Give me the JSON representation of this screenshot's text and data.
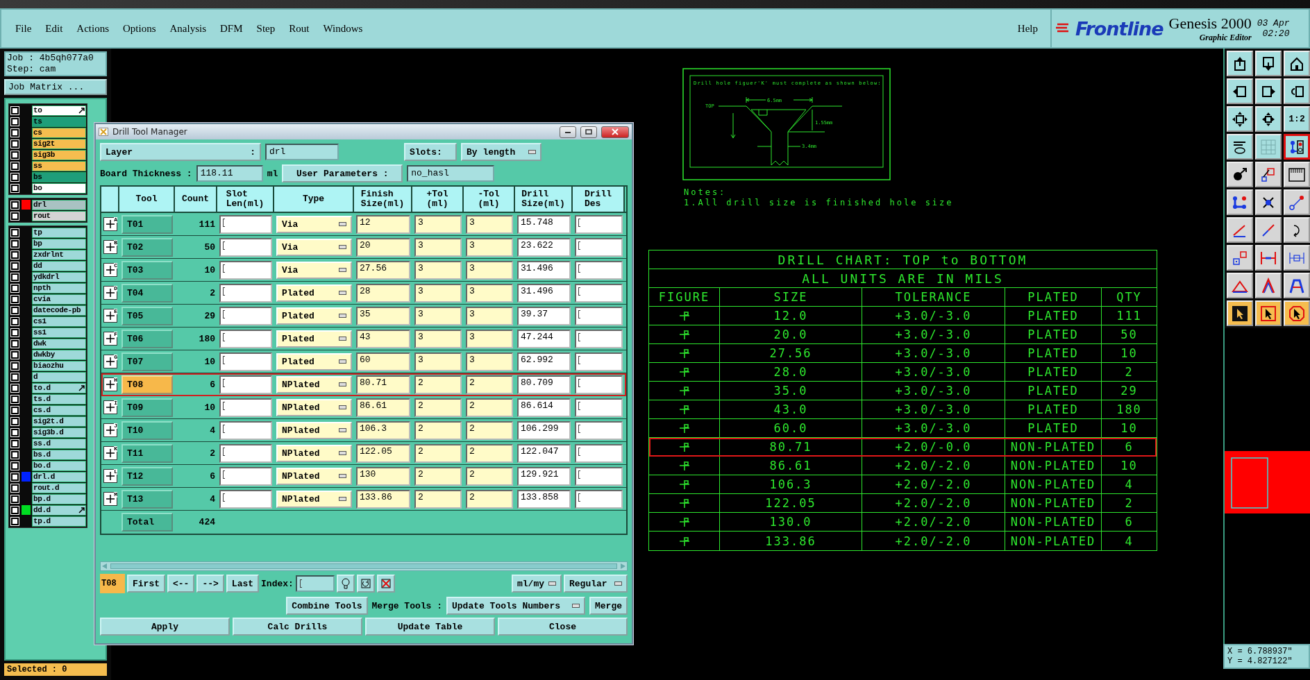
{
  "menu": {
    "items": [
      "File",
      "Edit",
      "Actions",
      "Options",
      "Analysis",
      "DFM",
      "Step",
      "Rout",
      "Windows"
    ],
    "help": "Help"
  },
  "logo": {
    "brand": "Frontline",
    "product": "Genesis 2000",
    "subtitle": "Graphic Editor",
    "date": "03 Apr",
    "time": "02:20"
  },
  "job": {
    "job": "Job : 4b5qh077a0",
    "step": "Step: cam",
    "matrix_button": "Job Matrix ..."
  },
  "layer_groups": [
    [
      {
        "name": "to",
        "kind": "silk",
        "linked": true,
        "checked": false
      },
      {
        "name": "ts",
        "kind": "mask",
        "linked": false,
        "checked": false
      },
      {
        "name": "cs",
        "kind": "signal",
        "linked": false,
        "checked": false
      },
      {
        "name": "sig2t",
        "kind": "signal",
        "linked": false,
        "checked": false
      },
      {
        "name": "sig3b",
        "kind": "signal",
        "linked": false,
        "checked": false
      },
      {
        "name": "ss",
        "kind": "signal",
        "linked": false,
        "checked": false
      },
      {
        "name": "bs",
        "kind": "mask",
        "linked": false,
        "checked": false
      },
      {
        "name": "bo",
        "kind": "silk",
        "linked": false,
        "checked": false
      }
    ],
    [
      {
        "name": "drl",
        "kind": "drill",
        "linked": false,
        "checked": false,
        "color": "#ff0000"
      },
      {
        "name": "rout",
        "kind": "rout",
        "linked": false,
        "checked": false
      }
    ],
    [
      {
        "name": "tp",
        "kind": "misc",
        "linked": false,
        "checked": false
      },
      {
        "name": "bp",
        "kind": "misc",
        "linked": false,
        "checked": false
      },
      {
        "name": "zxdrlnt",
        "kind": "misc",
        "linked": false,
        "checked": false
      },
      {
        "name": "dd",
        "kind": "misc",
        "linked": false,
        "checked": false
      },
      {
        "name": "ydkdrl",
        "kind": "misc",
        "linked": false,
        "checked": false
      },
      {
        "name": "npth",
        "kind": "misc",
        "linked": false,
        "checked": false
      },
      {
        "name": "cvia",
        "kind": "misc",
        "linked": false,
        "checked": false
      },
      {
        "name": "datecode-pb",
        "kind": "misc",
        "linked": false,
        "checked": false
      },
      {
        "name": "cs1",
        "kind": "misc",
        "linked": false,
        "checked": false
      },
      {
        "name": "ss1",
        "kind": "misc",
        "linked": false,
        "checked": false
      },
      {
        "name": "dwk",
        "kind": "misc",
        "linked": false,
        "checked": false
      },
      {
        "name": "dwkby",
        "kind": "misc",
        "linked": false,
        "checked": false
      },
      {
        "name": "biaozhu",
        "kind": "misc",
        "linked": false,
        "checked": false
      },
      {
        "name": "d",
        "kind": "misc",
        "linked": false,
        "checked": false
      },
      {
        "name": "to.d",
        "kind": "misc",
        "linked": true,
        "checked": false
      },
      {
        "name": "ts.d",
        "kind": "misc",
        "linked": false,
        "checked": false
      },
      {
        "name": "cs.d",
        "kind": "misc",
        "linked": false,
        "checked": false
      },
      {
        "name": "sig2t.d",
        "kind": "misc",
        "linked": false,
        "checked": false
      },
      {
        "name": "sig3b.d",
        "kind": "misc",
        "linked": false,
        "checked": false
      },
      {
        "name": "ss.d",
        "kind": "misc",
        "linked": false,
        "checked": false
      },
      {
        "name": "bs.d",
        "kind": "misc",
        "linked": false,
        "checked": false
      },
      {
        "name": "bo.d",
        "kind": "misc",
        "linked": false,
        "checked": false
      },
      {
        "name": "drl.d",
        "kind": "misc",
        "linked": false,
        "checked": false,
        "color": "#0022ff"
      },
      {
        "name": "rout.d",
        "kind": "misc",
        "linked": false,
        "checked": false
      },
      {
        "name": "bp.d",
        "kind": "misc",
        "linked": false,
        "checked": false
      },
      {
        "name": "dd.d",
        "kind": "misc",
        "linked": true,
        "checked": false,
        "color": "#00dd22"
      },
      {
        "name": "tp.d",
        "kind": "misc",
        "linked": false,
        "checked": false
      }
    ]
  ],
  "selected_count": "Selected : 0",
  "dialog": {
    "title": "Drill Tool Manager",
    "layer_label": "Layer",
    "layer_colon": ":",
    "layer_value": "drl",
    "slots_label": "Slots:",
    "slots_value": "By length",
    "thickness_label": "Board Thickness :",
    "thickness_value": "118.11",
    "thickness_unit": "ml",
    "user_params": "User Parameters :",
    "user_params_value": "no_hasl",
    "columns": [
      [
        "Tool"
      ],
      [
        "Count"
      ],
      [
        "Slot",
        "Len(ml)"
      ],
      [
        "Type"
      ],
      [
        "Finish",
        "Size(ml)"
      ],
      [
        "+Tol",
        "(ml)"
      ],
      [
        "-Tol",
        "(ml)"
      ],
      [
        "Drill",
        "Size(ml)"
      ],
      [
        "Drill",
        "Des"
      ]
    ],
    "rows": [
      {
        "figure": "A",
        "tool": "T01",
        "count": "111",
        "type": "Via",
        "finish": "12",
        "plus_tol": "3",
        "minus_tol": "3",
        "drill": "15.748",
        "selected": false,
        "highlighted": false
      },
      {
        "figure": "B",
        "tool": "T02",
        "count": "50",
        "type": "Via",
        "finish": "20",
        "plus_tol": "3",
        "minus_tol": "3",
        "drill": "23.622",
        "selected": false,
        "highlighted": false
      },
      {
        "figure": "C",
        "tool": "T03",
        "count": "10",
        "type": "Via",
        "finish": "27.56",
        "plus_tol": "3",
        "minus_tol": "3",
        "drill": "31.496",
        "selected": false,
        "highlighted": false
      },
      {
        "figure": "D",
        "tool": "T04",
        "count": "2",
        "type": "Plated",
        "finish": "28",
        "plus_tol": "3",
        "minus_tol": "3",
        "drill": "31.496",
        "selected": false,
        "highlighted": false
      },
      {
        "figure": "E",
        "tool": "T05",
        "count": "29",
        "type": "Plated",
        "finish": "35",
        "plus_tol": "3",
        "minus_tol": "3",
        "drill": "39.37",
        "selected": false,
        "highlighted": false
      },
      {
        "figure": "F",
        "tool": "T06",
        "count": "180",
        "type": "Plated",
        "finish": "43",
        "plus_tol": "3",
        "minus_tol": "3",
        "drill": "47.244",
        "selected": false,
        "highlighted": false
      },
      {
        "figure": "G",
        "tool": "T07",
        "count": "10",
        "type": "Plated",
        "finish": "60",
        "plus_tol": "3",
        "minus_tol": "3",
        "drill": "62.992",
        "selected": false,
        "highlighted": false
      },
      {
        "figure": "H",
        "tool": "T08",
        "count": "6",
        "type": "NPlated",
        "finish": "80.71",
        "plus_tol": "2",
        "minus_tol": "2",
        "drill": "80.709",
        "selected": true,
        "highlighted": true
      },
      {
        "figure": "I",
        "tool": "T09",
        "count": "10",
        "type": "NPlated",
        "finish": "86.61",
        "plus_tol": "2",
        "minus_tol": "2",
        "drill": "86.614",
        "selected": false,
        "highlighted": false
      },
      {
        "figure": "J",
        "tool": "T10",
        "count": "4",
        "type": "NPlated",
        "finish": "106.3",
        "plus_tol": "2",
        "minus_tol": "2",
        "drill": "106.299",
        "selected": false,
        "highlighted": false
      },
      {
        "figure": "K",
        "tool": "T11",
        "count": "2",
        "type": "NPlated",
        "finish": "122.05",
        "plus_tol": "2",
        "minus_tol": "2",
        "drill": "122.047",
        "selected": false,
        "highlighted": false
      },
      {
        "figure": "L",
        "tool": "T12",
        "count": "6",
        "type": "NPlated",
        "finish": "130",
        "plus_tol": "2",
        "minus_tol": "2",
        "drill": "129.921",
        "selected": false,
        "highlighted": false
      },
      {
        "figure": "M",
        "tool": "T13",
        "count": "4",
        "type": "NPlated",
        "finish": "133.86",
        "plus_tol": "2",
        "minus_tol": "2",
        "drill": "133.858",
        "selected": false,
        "highlighted": false
      }
    ],
    "total_label": "Total",
    "total_count": "424",
    "current_tool": "T08",
    "nav_buttons": [
      "First",
      "<--",
      "-->",
      "Last"
    ],
    "index_label": "Index:",
    "units": "ml/my",
    "mode": "Regular",
    "combine_button": "Combine Tools",
    "merge_label": "Merge Tools :",
    "merge_option": "Update Tools Numbers",
    "merge_button": "Merge",
    "actions": [
      "Apply",
      "Calc Drills",
      "Update Table",
      "Close"
    ]
  },
  "figure": {
    "caption": "Drill hole figuer'K' must complete as shown below:",
    "top_label": "TOP",
    "width_label": "6.5mm",
    "depth_label": "1.55mm",
    "hole_label": "3.4mm"
  },
  "notes": [
    "Notes:",
    "1.All drill size is finished hole size"
  ],
  "chart": {
    "title": "DRILL CHART: TOP to BOTTOM",
    "subtitle": "ALL UNITS ARE IN MILS",
    "columns": [
      "FIGURE",
      "SIZE",
      "TOLERANCE",
      "PLATED",
      "QTY"
    ],
    "rows": [
      {
        "size": "12.0",
        "tolerance": "+3.0/-3.0",
        "plated": "PLATED",
        "qty": "111",
        "highlighted": false
      },
      {
        "size": "20.0",
        "tolerance": "+3.0/-3.0",
        "plated": "PLATED",
        "qty": "50",
        "highlighted": false
      },
      {
        "size": "27.56",
        "tolerance": "+3.0/-3.0",
        "plated": "PLATED",
        "qty": "10",
        "highlighted": false
      },
      {
        "size": "28.0",
        "tolerance": "+3.0/-3.0",
        "plated": "PLATED",
        "qty": "2",
        "highlighted": false
      },
      {
        "size": "35.0",
        "tolerance": "+3.0/-3.0",
        "plated": "PLATED",
        "qty": "29",
        "highlighted": false
      },
      {
        "size": "43.0",
        "tolerance": "+3.0/-3.0",
        "plated": "PLATED",
        "qty": "180",
        "highlighted": false
      },
      {
        "size": "60.0",
        "tolerance": "+3.0/-3.0",
        "plated": "PLATED",
        "qty": "10",
        "highlighted": false
      },
      {
        "size": "80.71",
        "tolerance": "+2.0/-0.0",
        "plated": "NON-PLATED",
        "qty": "6",
        "highlighted": true
      },
      {
        "size": "86.61",
        "tolerance": "+2.0/-2.0",
        "plated": "NON-PLATED",
        "qty": "10",
        "highlighted": false
      },
      {
        "size": "106.3",
        "tolerance": "+2.0/-2.0",
        "plated": "NON-PLATED",
        "qty": "4",
        "highlighted": false
      },
      {
        "size": "122.05",
        "tolerance": "+2.0/-2.0",
        "plated": "NON-PLATED",
        "qty": "2",
        "highlighted": false
      },
      {
        "size": "130.0",
        "tolerance": "+2.0/-2.0",
        "plated": "NON-PLATED",
        "qty": "6",
        "highlighted": false
      },
      {
        "size": "133.86",
        "tolerance": "+2.0/-2.0",
        "plated": "NON-PLATED",
        "qty": "4",
        "highlighted": false
      }
    ]
  },
  "tools": [
    {
      "kind": "view",
      "selected": false
    },
    {
      "kind": "view",
      "selected": false
    },
    {
      "kind": "view",
      "selected": false
    },
    {
      "kind": "view",
      "selected": false
    },
    {
      "kind": "view",
      "selected": false
    },
    {
      "kind": "view",
      "selected": false
    },
    {
      "kind": "view",
      "selected": false
    },
    {
      "kind": "view",
      "selected": false
    },
    {
      "kind": "view",
      "selected": false,
      "label": "1:2"
    },
    {
      "kind": "view",
      "selected": false
    },
    {
      "kind": "view",
      "selected": false
    },
    {
      "kind": "view",
      "selected": true
    },
    {
      "kind": "edit",
      "selected": false
    },
    {
      "kind": "edit",
      "selected": false
    },
    {
      "kind": "edit",
      "selected": false
    },
    {
      "kind": "edit",
      "selected": false
    },
    {
      "kind": "edit",
      "selected": false
    },
    {
      "kind": "edit",
      "selected": false
    },
    {
      "kind": "edit",
      "selected": false
    },
    {
      "kind": "edit",
      "selected": false
    },
    {
      "kind": "edit",
      "selected": false
    },
    {
      "kind": "edit",
      "selected": false
    },
    {
      "kind": "edit",
      "selected": false
    },
    {
      "kind": "edit",
      "selected": false
    },
    {
      "kind": "edit",
      "selected": false
    },
    {
      "kind": "edit",
      "selected": false
    },
    {
      "kind": "edit",
      "selected": false
    },
    {
      "kind": "select",
      "selected": false
    },
    {
      "kind": "select",
      "selected": false
    },
    {
      "kind": "select",
      "selected": false
    }
  ],
  "coordinates": [
    "X = 6.788937\"",
    "Y = 4.827122\""
  ]
}
